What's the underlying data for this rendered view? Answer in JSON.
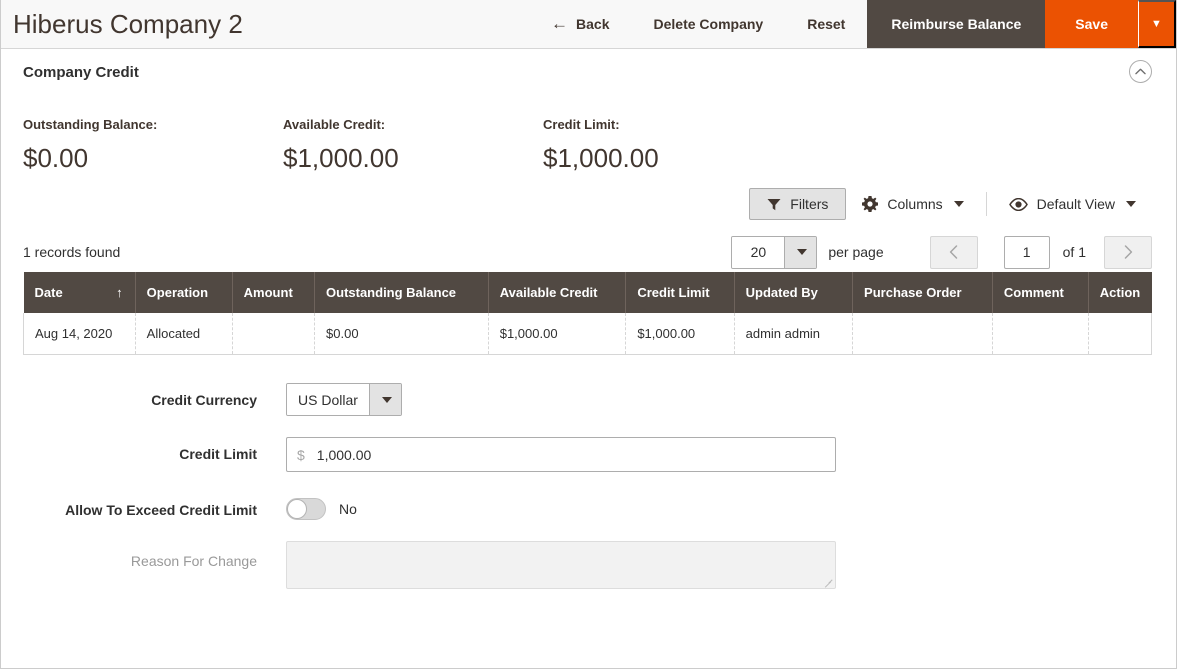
{
  "header": {
    "title": "Hiberus Company 2",
    "actions": [
      {
        "label": "Back",
        "icon": "arrow-left-icon",
        "style": "link"
      },
      {
        "label": "Delete Company",
        "style": "link"
      },
      {
        "label": "Reset",
        "style": "link"
      },
      {
        "label": "Reimburse Balance",
        "style": "dark"
      },
      {
        "label": "Save",
        "style": "primary"
      }
    ],
    "save_caret": "▼"
  },
  "section": {
    "title": "Company Credit",
    "collapse_icon": "chevron-up-icon"
  },
  "summary": [
    {
      "label": "Outstanding Balance:",
      "value": "$0.00"
    },
    {
      "label": "Available Credit:",
      "value": "$1,000.00"
    },
    {
      "label": "Credit Limit:",
      "value": "$1,000.00"
    }
  ],
  "toolbar": {
    "filters_label": "Filters",
    "filters_icon": "funnel-icon",
    "columns_label": "Columns",
    "columns_icon": "gear-icon",
    "view_label": "Default View",
    "view_icon": "eye-icon"
  },
  "pager": {
    "records_found": "1 records found",
    "per_page_value": "20",
    "per_page_label": "per page",
    "prev_icon": "chevron-left-icon",
    "next_icon": "chevron-right-icon",
    "current_page": "1",
    "of_label": "of 1"
  },
  "grid": {
    "columns": [
      {
        "label": "Date",
        "sort": "↑",
        "width": "9.9%"
      },
      {
        "label": "Operation",
        "width": "8.6%"
      },
      {
        "label": "Amount",
        "width": "7.3%"
      },
      {
        "label": "Outstanding Balance",
        "width": "15.4%"
      },
      {
        "label": "Available Credit",
        "width": "12.2%"
      },
      {
        "label": "Credit Limit",
        "width": "9.6%"
      },
      {
        "label": "Updated By",
        "width": "10.5%"
      },
      {
        "label": "Purchase Order",
        "width": "12.4%"
      },
      {
        "label": "Comment",
        "width": "8.5%"
      },
      {
        "label": "Action",
        "width": "5.6%"
      }
    ],
    "rows": [
      {
        "date": "Aug 14, 2020",
        "operation": "Allocated",
        "amount": "",
        "outstanding_balance": "$0.00",
        "available_credit": "$1,000.00",
        "credit_limit": "$1,000.00",
        "updated_by": "admin admin",
        "purchase_order": "",
        "comment": "",
        "action": ""
      }
    ]
  },
  "form": {
    "credit_currency_label": "Credit Currency",
    "credit_currency_value": "US Dollar",
    "credit_limit_label": "Credit Limit",
    "credit_limit_prefix": "$",
    "credit_limit_value": "1,000.00",
    "allow_exceed_label": "Allow To Exceed Credit Limit",
    "allow_exceed_state": "No",
    "reason_label": "Reason For Change",
    "reason_value": ""
  },
  "colors": {
    "brand_orange": "#eb5202",
    "dark_brown": "#514943",
    "header_bg": "#f8f8f8",
    "title_text": "#41362f"
  }
}
